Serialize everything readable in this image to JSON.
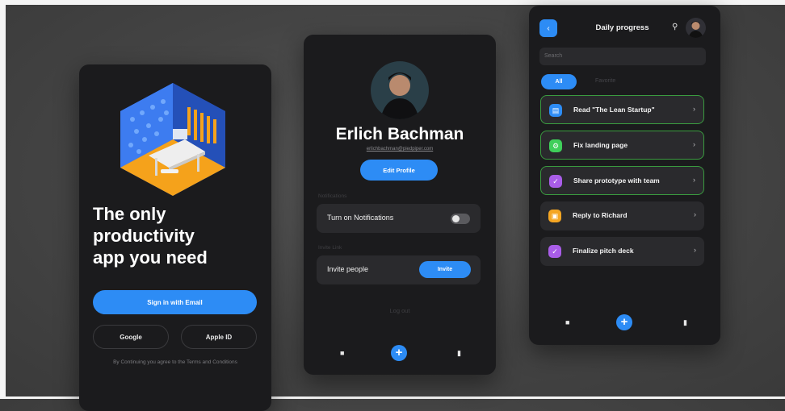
{
  "login": {
    "hero_title": "The only\nproductivity\napp you need",
    "sign_in_email": "Sign in with Email",
    "google": "Google",
    "apple": "Apple ID",
    "terms": "By Continuing you agree to the Terms and Conditions"
  },
  "profile": {
    "name": "Erlich Bachman",
    "email": "erlichbachman@piedpiper.com",
    "edit_button": "Edit Profile",
    "notifications_label": "Notifications",
    "notifications_row": "Turn on Notifications",
    "notifications_on": false,
    "invite_label": "Invite Link",
    "invite_row": "Invite people",
    "invite_button": "Invite",
    "logout": "Log out"
  },
  "tasks": {
    "title": "Daily progress",
    "search_placeholder": "Search",
    "filter_all": "All",
    "filter_favorite": "Favorite",
    "items": [
      {
        "label": "Read \"The Lean Startup\"",
        "icon": "book-icon",
        "color": "#2d8cf5",
        "highlight": true
      },
      {
        "label": "Fix landing page",
        "icon": "wrench-icon",
        "color": "#3fcf5a",
        "highlight": true
      },
      {
        "label": "Share prototype with team",
        "icon": "check-icon",
        "color": "#a95de8",
        "highlight": true
      },
      {
        "label": "Reply to Richard",
        "icon": "chat-icon",
        "color": "#f5a623",
        "highlight": false
      },
      {
        "label": "Finalize pitch deck",
        "icon": "check-icon",
        "color": "#a95de8",
        "highlight": false
      }
    ]
  },
  "colors": {
    "accent": "#2d8cf5",
    "phone_bg": "#1b1b1d",
    "card_bg": "#2a2a2d",
    "highlight_border": "#3a9b3f"
  }
}
